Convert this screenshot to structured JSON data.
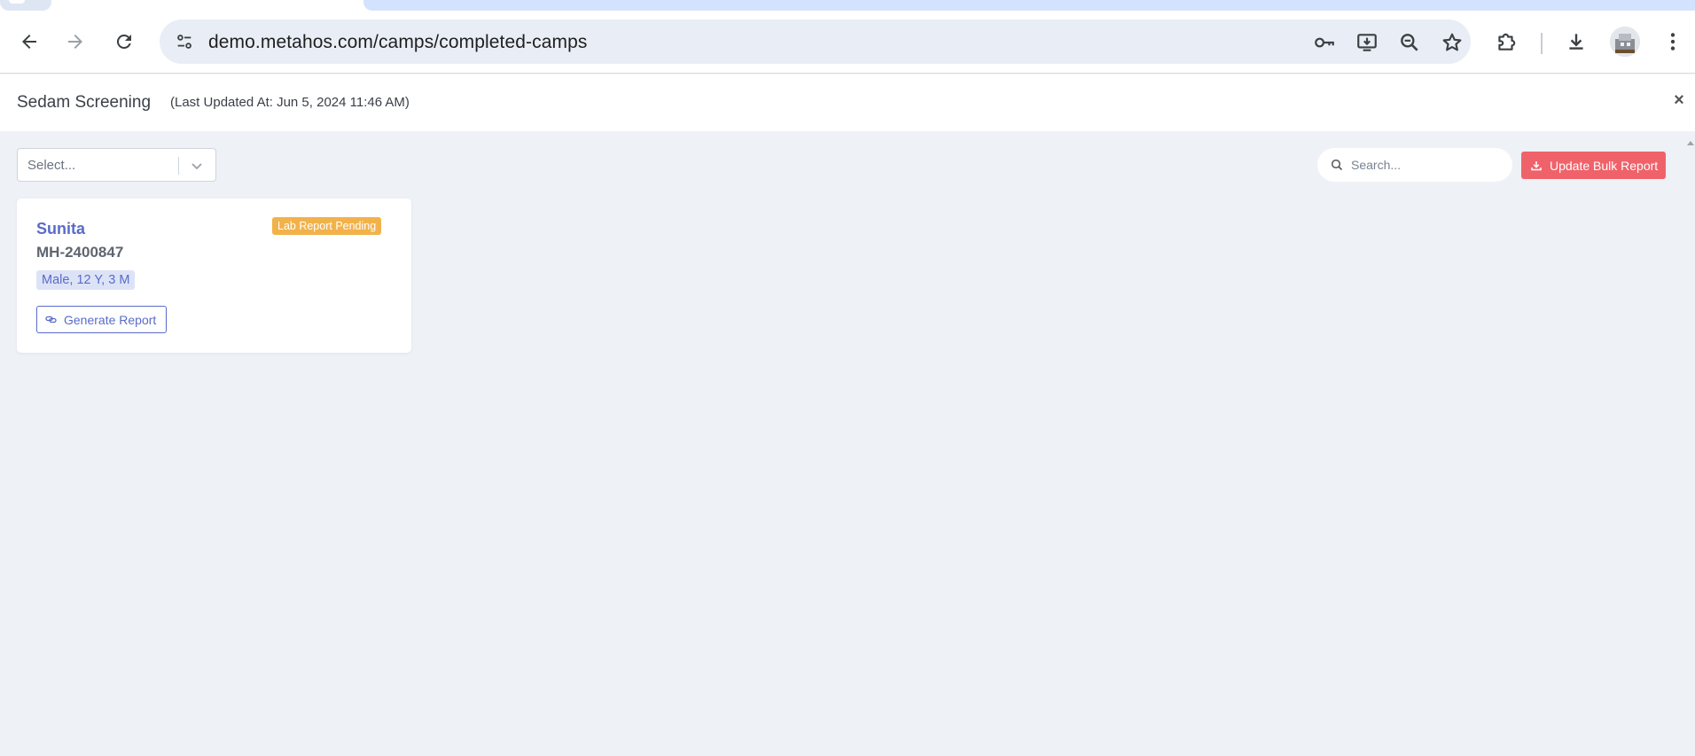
{
  "browser": {
    "url": "demo.metahos.com/camps/completed-camps",
    "icons": {
      "back": "arrow-left",
      "forward": "arrow-right",
      "reload": "reload",
      "site_info": "tune",
      "password": "key",
      "install": "install-desktop",
      "zoom": "zoom-out",
      "bookmark": "star",
      "extensions": "puzzle",
      "downloads": "download",
      "menu": "more-vert"
    }
  },
  "header": {
    "title": "Sedam Screening",
    "last_updated": "(Last Updated At: Jun 5, 2024 11:46 AM)",
    "close_label": "×"
  },
  "filters": {
    "select_placeholder": "Select...",
    "search_placeholder": "Search...",
    "bulk_button_label": "Update Bulk Report"
  },
  "patients": [
    {
      "name": "Sunita",
      "id": "MH-2400847",
      "demographics": "Male, 12 Y, 3 M",
      "status": "Lab Report Pending",
      "action_label": "Generate Report"
    }
  ],
  "colors": {
    "accent": "#5a6bc9",
    "danger": "#f0626a",
    "warning": "#f2b24a",
    "page_bg": "#eef1f6"
  }
}
